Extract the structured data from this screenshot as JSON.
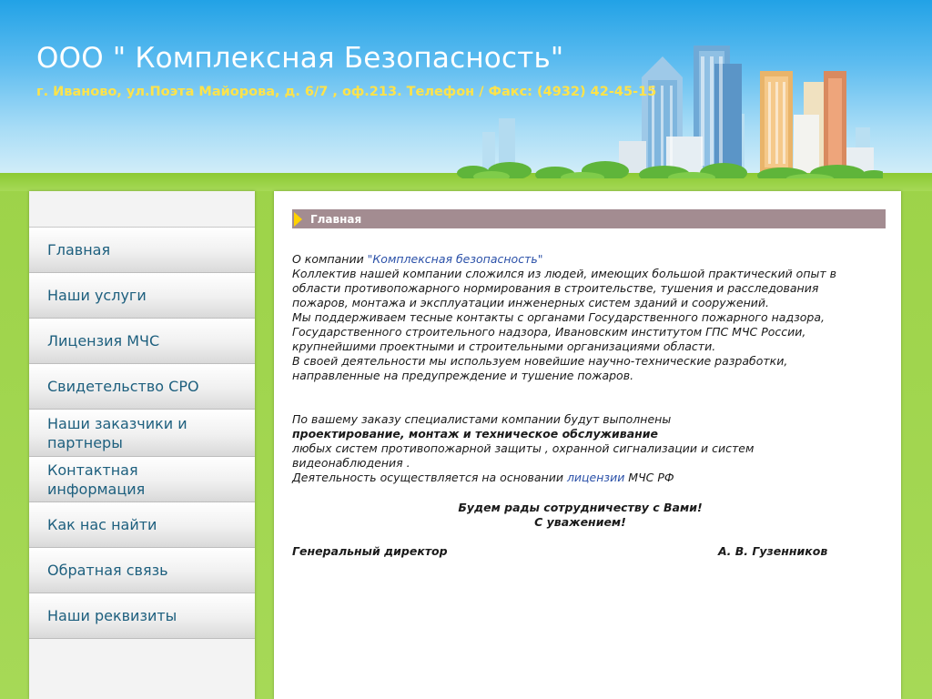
{
  "header": {
    "title": "ООО \" Комплексная Безопасность\"",
    "address": "г. Иваново, ул.Поэта Майорова, д. 6/7 , оф.213. Телефон / Факс: (4932) 42-45-15"
  },
  "menu": {
    "items": [
      {
        "label": "Главная"
      },
      {
        "label": "Наши услуги"
      },
      {
        "label": "Лицензия МЧС"
      },
      {
        "label": "Свидетельство СРО"
      },
      {
        "label": "Наши заказчики и партнеры"
      },
      {
        "label": "Контактная информация"
      },
      {
        "label": "Как нас найти"
      },
      {
        "label": "Обратная связь"
      },
      {
        "label": "Наши реквизиты"
      }
    ]
  },
  "content": {
    "section_title": "Главная",
    "about_prefix": "О компании ",
    "about_link": "\"Комплексная безопасность\"",
    "paragraph1": "Коллектив нашей компании сложился из людей, имеющих большой практический опыт в области противопожарного нормирования в строительстве, тушения и расследования пожаров, монтажа и эксплуатации инженерных систем зданий и сооружений.",
    "paragraph2": "Мы поддерживаем тесные контакты с органами Государственного пожарного надзора, Государственного строительного надзора, Ивановским институтом ГПС МЧС России, крупнейшими проектными и строительными организациями области.",
    "paragraph3": "В своей деятельности мы используем новейшие научно-технические разработки, направленные на предупреждение и тушение пожаров.",
    "services_intro": "По вашему заказу специалистами компании будут выполнены",
    "services_bold": "проектирование, монтаж и техническое обслуживание",
    "services_rest": "любых систем противопожарной защиты , охранной сигнализации и систем видеонаблюдения .",
    "basis_prefix": "Деятельность осуществляется на основании ",
    "basis_link": "лицензии",
    "basis_suffix": " МЧС РФ",
    "closing1": "Будем рады сотрудничеству с Вами!",
    "closing2": "С уважением!",
    "signature_title": "Генеральный директор",
    "signature_name": "А. В. Гузенников"
  },
  "colors": {
    "header_sky": "#22a2e6",
    "title_text": "#ffffff",
    "address_text": "#ffe34a",
    "menu_text": "#1d5f7e",
    "section_bar": "#a38c91",
    "link": "#2a50a8",
    "background_green": "#a6d957"
  }
}
